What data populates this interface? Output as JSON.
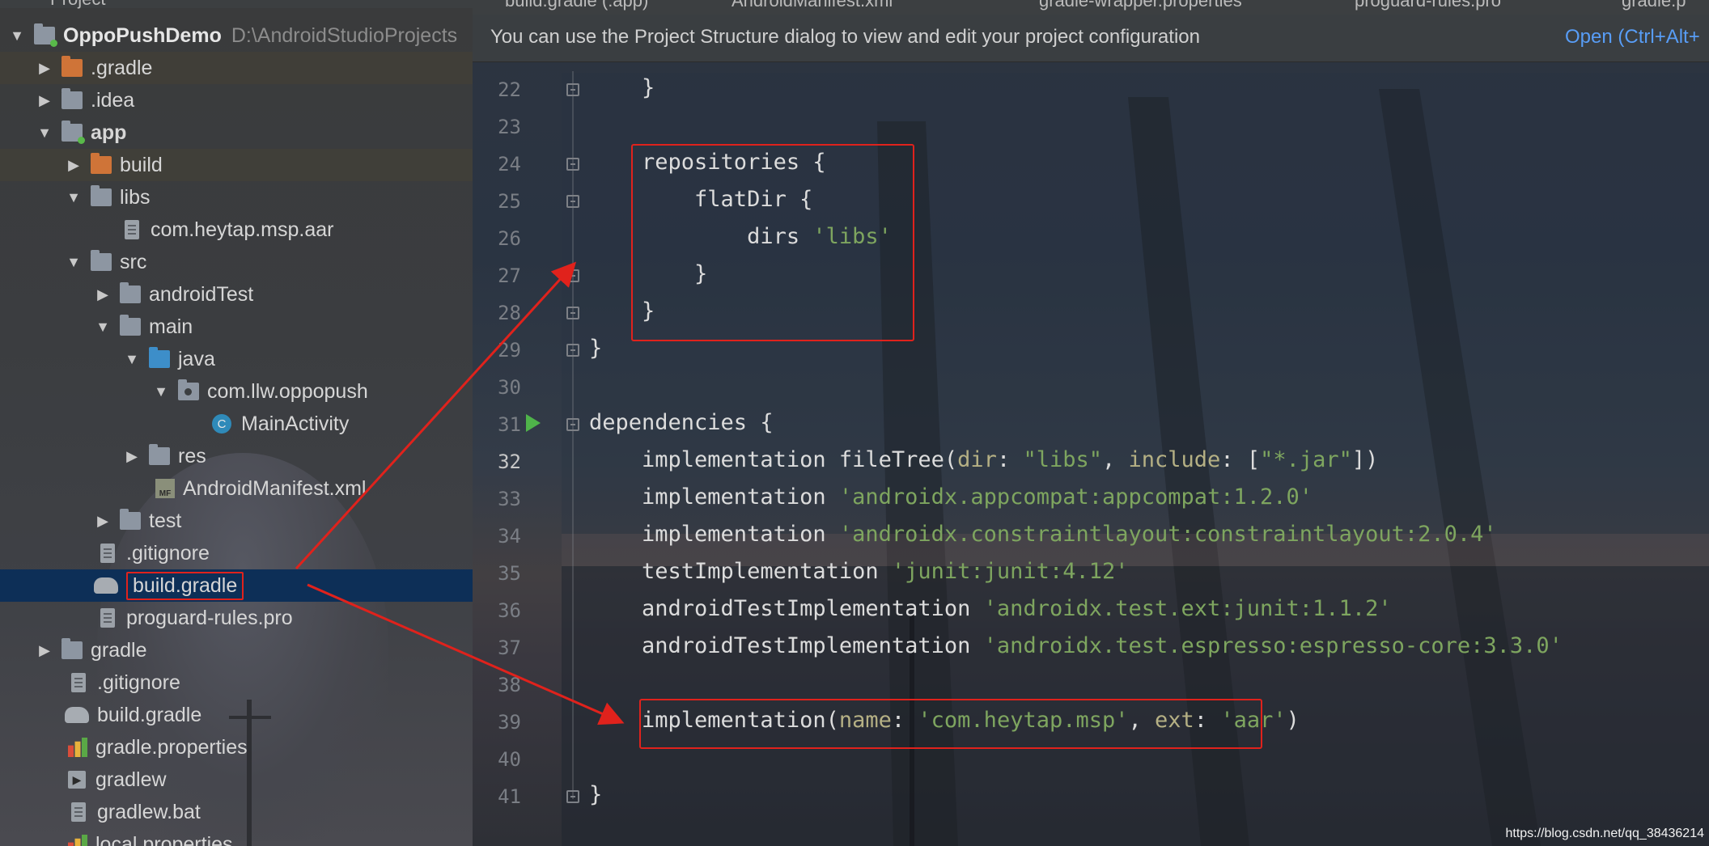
{
  "tabs": [
    {
      "label": "build.gradle (:app)",
      "active": true
    },
    {
      "label": "AndroidManifest.xml"
    },
    {
      "label": "gradle-wrapper.properties"
    },
    {
      "label": "proguard-rules.pro"
    },
    {
      "label": "gradle.p"
    }
  ],
  "sidebar": {
    "header": "Project",
    "project_name": "OppoPushDemo",
    "project_path": "D:\\AndroidStudioProjects",
    "items": [
      {
        "label": ".gradle"
      },
      {
        "label": ".idea"
      },
      {
        "label": "app"
      },
      {
        "label": "build"
      },
      {
        "label": "libs"
      },
      {
        "label": "com.heytap.msp.aar"
      },
      {
        "label": "src"
      },
      {
        "label": "androidTest"
      },
      {
        "label": "main"
      },
      {
        "label": "java"
      },
      {
        "label": "com.llw.oppopush"
      },
      {
        "label": "MainActivity"
      },
      {
        "label": "res"
      },
      {
        "label": "AndroidManifest.xml"
      },
      {
        "label": "test"
      },
      {
        "label": ".gitignore"
      },
      {
        "label": "build.gradle"
      },
      {
        "label": "proguard-rules.pro"
      },
      {
        "label": "gradle"
      },
      {
        "label": ".gitignore"
      },
      {
        "label": "build.gradle"
      },
      {
        "label": "gradle.properties"
      },
      {
        "label": "gradlew"
      },
      {
        "label": "gradlew.bat"
      },
      {
        "label": "local.properties"
      }
    ]
  },
  "notification": {
    "message": "You can use the Project Structure dialog to view and edit your project configuration",
    "link": "Open (Ctrl+Alt+"
  },
  "editor": {
    "line_numbers": [
      "22",
      "23",
      "24",
      "25",
      "26",
      "27",
      "28",
      "29",
      "30",
      "31",
      "32",
      "33",
      "34",
      "35",
      "36",
      "37",
      "38",
      "39",
      "40",
      "41"
    ],
    "current_line": "32"
  },
  "watermark": "https://blog.csdn.net/qq_38436214",
  "colors": {
    "highlight_box": "#e0221c",
    "string": "#7ea55f",
    "named_arg": "#b5b084",
    "selection": "#0d2f57"
  }
}
